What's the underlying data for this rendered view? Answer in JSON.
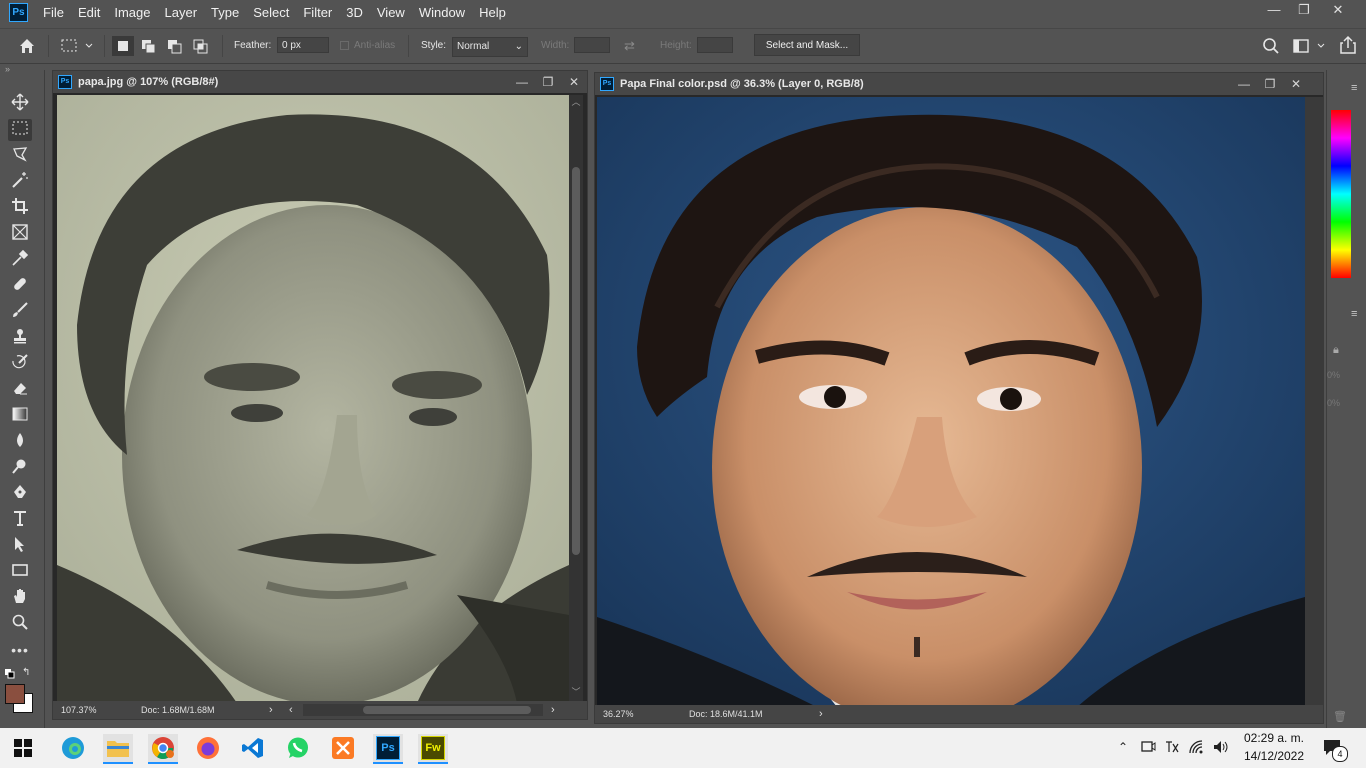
{
  "app": {
    "logo": "Ps"
  },
  "menu": [
    "File",
    "Edit",
    "Image",
    "Layer",
    "Type",
    "Select",
    "Filter",
    "3D",
    "View",
    "Window",
    "Help"
  ],
  "window_controls": {
    "minimize": "—",
    "restore": "❐",
    "close": "✕"
  },
  "options": {
    "feather_label": "Feather:",
    "feather_value": "0 px",
    "antialias_label": "Anti-alias",
    "style_label": "Style:",
    "style_value": "Normal",
    "width_label": "Width:",
    "height_label": "Height:",
    "select_mask": "Select and Mask..."
  },
  "tools": [
    "move-icon",
    "rect-marquee-icon",
    "lasso-icon",
    "magic-wand-icon",
    "crop-icon",
    "frame-icon",
    "eyedropper-icon",
    "healing-icon",
    "brush-icon",
    "stamp-icon",
    "history-brush-icon",
    "eraser-icon",
    "gradient-icon",
    "blur-icon",
    "dodge-icon",
    "pen-icon",
    "type-icon",
    "path-select-icon",
    "rectangle-icon",
    "hand-icon",
    "zoom-icon",
    "more-icon"
  ],
  "colors": {
    "foreground": "#8a4f3f",
    "background": "#ffffff",
    "accent": "#31a8ff"
  },
  "doc1": {
    "title": "papa.jpg @ 107% (RGB/8#)",
    "zoom": "107.37%",
    "doc_size": "Doc: 1.68M/1.68M"
  },
  "doc2": {
    "title": "Papa Final color.psd @ 36.3% (Layer 0, RGB/8)",
    "zoom": "36.27%",
    "doc_size": "Doc: 18.6M/41.1M"
  },
  "panels": {
    "pct1": "0%",
    "pct2": "0%"
  },
  "taskbar": {
    "apps": [
      "windows-start-icon",
      "edge-icon",
      "file-explorer-icon",
      "chrome-icon",
      "firefox-icon",
      "vscode-icon",
      "whatsapp-icon",
      "xampp-icon",
      "photoshop-icon",
      "fireworks-icon"
    ],
    "ps_label": "Ps",
    "fw_label": "Fw",
    "time": "02:29 a. m.",
    "date": "14/12/2022",
    "notifications": "4"
  }
}
